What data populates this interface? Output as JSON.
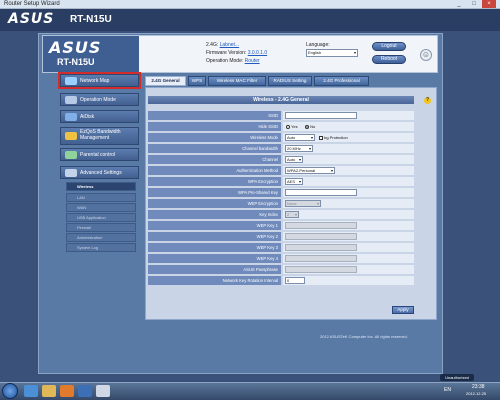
{
  "window": {
    "title": "Router Setup Wizard",
    "controls": [
      "_",
      "□",
      "×"
    ]
  },
  "brand": {
    "logo": "ASUS",
    "model": "RT-N15U"
  },
  "banner": {
    "logo": "ASUS",
    "model": "RT-N15U",
    "ssid_label": "2.4G:",
    "ssid_value": "Labnet...",
    "firmware_label": "Firmware Version:",
    "firmware_value": "3.0.0.1.0",
    "opmode_label": "Operation Mode:",
    "opmode_value": "Router",
    "language_label": "Language:",
    "language_value": "English",
    "logout": "Logout",
    "reboot": "Reboot"
  },
  "sidebar": {
    "items": [
      {
        "label": "Network Map",
        "highlight": true
      },
      {
        "label": "Operation Mode"
      },
      {
        "label": "AiDisk"
      },
      {
        "label": "EzQoS Bandwidth Management"
      },
      {
        "label": "Parental control"
      },
      {
        "label": "Advanced Settings"
      }
    ],
    "sub": [
      {
        "label": "Wireless",
        "active": true
      },
      {
        "label": "LAN"
      },
      {
        "label": "WAN"
      },
      {
        "label": "USB Application"
      },
      {
        "label": "Firewall"
      },
      {
        "label": "Administration"
      },
      {
        "label": "System Log"
      }
    ]
  },
  "tabs": [
    "2.4G General",
    "WPS",
    "Wireless MAC Filter",
    "RADIUS Setting",
    "2.4G Professional"
  ],
  "content": {
    "title": "Wireless - 2.4G General",
    "fields": {
      "ssid": {
        "label": "SSID",
        "value": ""
      },
      "hide_ssid": {
        "label": "Hide SSID",
        "yes": "Yes",
        "no": "No"
      },
      "wireless_mode": {
        "label": "Wireless Mode",
        "value": "Auto",
        "extra": "bg Protection"
      },
      "bandwidth": {
        "label": "Channel bandwidth",
        "value": "20 MHz"
      },
      "channel": {
        "label": "Channel",
        "value": "Auto"
      },
      "auth": {
        "label": "Authentication Method",
        "value": "WPA2-Personal"
      },
      "wpa_enc": {
        "label": "WPA Encryption",
        "value": "AES"
      },
      "wpa_key": {
        "label": "WPA Pre-Shared Key",
        "value": ""
      },
      "wep_enc": {
        "label": "WEP Encryption",
        "value": "None"
      },
      "key_index": {
        "label": "Key Index",
        "value": "2"
      },
      "wep1": {
        "label": "WEP Key 1"
      },
      "wep2": {
        "label": "WEP Key 2"
      },
      "wep3": {
        "label": "WEP Key 3"
      },
      "wep4": {
        "label": "WEP Key 4"
      },
      "asus_pass": {
        "label": "ASUS Passphrase"
      },
      "rotation": {
        "label": "Network Key Rotation Interval",
        "value": "0"
      }
    },
    "apply": "Apply"
  },
  "footer": {
    "copyright": "2012 ASUSTeK Computer Inc. All rights reserved."
  },
  "taskbar": {
    "language": "EN",
    "time": "23:38",
    "date": "2012.12.25",
    "tray_button": "Unauthorized"
  }
}
